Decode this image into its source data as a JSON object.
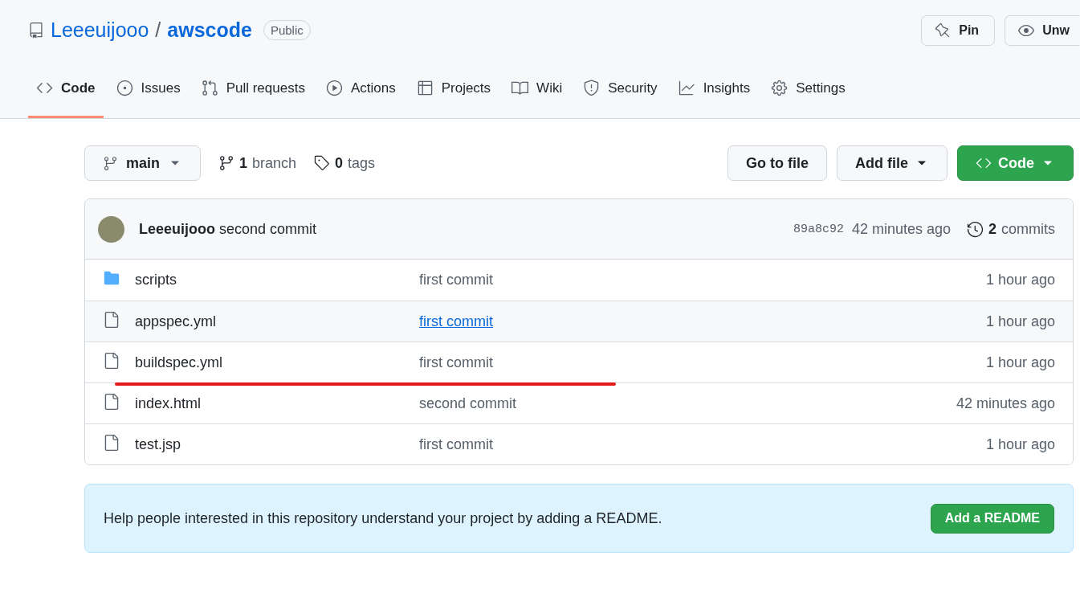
{
  "repo": {
    "owner": "Leeeuijooo",
    "separator": "/",
    "name": "awscode",
    "visibility": "Public"
  },
  "header_actions": [
    {
      "label": "Pin"
    },
    {
      "label": "Unw"
    }
  ],
  "tabs": [
    {
      "label": "Code",
      "selected": true
    },
    {
      "label": "Issues",
      "selected": false
    },
    {
      "label": "Pull requests",
      "selected": false
    },
    {
      "label": "Actions",
      "selected": false
    },
    {
      "label": "Projects",
      "selected": false
    },
    {
      "label": "Wiki",
      "selected": false
    },
    {
      "label": "Security",
      "selected": false
    },
    {
      "label": "Insights",
      "selected": false
    },
    {
      "label": "Settings",
      "selected": false
    }
  ],
  "branch_bar": {
    "branch": "main",
    "branches_count": "1",
    "branches_label": "branch",
    "tags_count": "0",
    "tags_label": "tags",
    "buttons": [
      "Go to file",
      "Add file"
    ],
    "code_button": "Code"
  },
  "latest_commit": {
    "author": "Leeeuijooo",
    "message": "second commit",
    "sha": "89a8c92",
    "time": "42 minutes ago",
    "commits_count": "2",
    "commits_label": "commits"
  },
  "files": [
    {
      "kind": "dir",
      "name": "scripts",
      "message": "first commit",
      "time": "1 hour ago",
      "hovered": false
    },
    {
      "kind": "file",
      "name": "appspec.yml",
      "message": "first commit",
      "time": "1 hour ago",
      "hovered": true
    },
    {
      "kind": "file",
      "name": "buildspec.yml",
      "message": "first commit",
      "time": "1 hour ago",
      "hovered": false
    },
    {
      "kind": "file",
      "name": "index.html",
      "message": "second commit",
      "time": "42 minutes ago",
      "hovered": false
    },
    {
      "kind": "file",
      "name": "test.jsp",
      "message": "first commit",
      "time": "1 hour ago",
      "hovered": false
    }
  ],
  "readme_banner": {
    "text": "Help people interested in this repository understand your project by adding a README.",
    "button": "Add a README"
  }
}
